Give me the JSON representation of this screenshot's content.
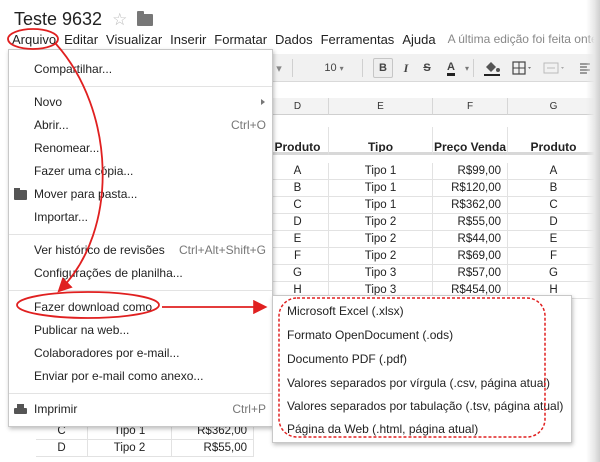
{
  "document": {
    "title": "Teste 9632",
    "star_glyph": "☆"
  },
  "menubar": {
    "items": [
      "Arquivo",
      "Editar",
      "Visualizar",
      "Inserir",
      "Formatar",
      "Dados",
      "Ferramentas",
      "Ajuda"
    ],
    "last_edit": "A última edição foi feita ontem às"
  },
  "toolbar": {
    "font_size": "10",
    "bold": "B",
    "italic": "I",
    "strikethrough": "S",
    "text_color": "A"
  },
  "sheet": {
    "columns": [
      "D",
      "E",
      "F",
      "G"
    ],
    "headers": [
      "Produto",
      "Tipo",
      "Preço Venda",
      "Produto"
    ],
    "rows": [
      [
        "A",
        "Tipo 1",
        "R$99,00",
        "A"
      ],
      [
        "B",
        "Tipo 1",
        "R$120,00",
        "B"
      ],
      [
        "C",
        "Tipo 1",
        "R$362,00",
        "C"
      ],
      [
        "D",
        "Tipo 2",
        "R$55,00",
        "D"
      ],
      [
        "E",
        "Tipo 2",
        "R$44,00",
        "E"
      ],
      [
        "F",
        "Tipo 2",
        "R$69,00",
        "F"
      ],
      [
        "G",
        "Tipo 3",
        "R$57,00",
        "G"
      ],
      [
        "H",
        "Tipo 3",
        "R$454,00",
        "H"
      ]
    ],
    "bottom_rows": [
      [
        "C",
        "Tipo 1",
        "R$362,00"
      ],
      [
        "D",
        "Tipo 2",
        "R$55,00"
      ]
    ]
  },
  "file_menu": {
    "share": "Compartilhar...",
    "new": "Novo",
    "open": "Abrir...",
    "open_shortcut": "Ctrl+O",
    "rename": "Renomear...",
    "make_copy": "Fazer uma cópia...",
    "move_to_folder": "Mover para pasta...",
    "import": "Importar...",
    "revision_history": "Ver histórico de revisões",
    "revision_history_shortcut": "Ctrl+Alt+Shift+G",
    "spreadsheet_settings": "Configurações de planilha...",
    "download_as": "Fazer download como",
    "publish": "Publicar na web...",
    "email_collaborators": "Colaboradores por e-mail...",
    "email_attachment": "Enviar por e-mail como anexo...",
    "print": "Imprimir",
    "print_shortcut": "Ctrl+P"
  },
  "download_submenu": {
    "items": [
      "Microsoft Excel (.xlsx)",
      "Formato OpenDocument (.ods)",
      "Documento PDF (.pdf)",
      "Valores separados por vírgula (.csv, página atual)",
      "Valores separados por tabulação (.tsv, página atual)",
      "Página da Web (.html, página atual)"
    ]
  },
  "colors": {
    "annotation": "#e02020",
    "toolbar_bg": "#f1f1f1"
  }
}
